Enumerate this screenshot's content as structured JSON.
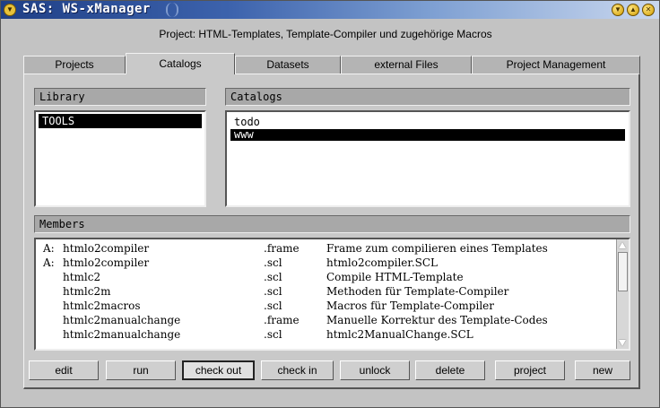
{
  "window": {
    "title": "SAS: WS-xManager"
  },
  "project": {
    "line": "Project: HTML-Templates, Template-Compiler und zugehörige Macros"
  },
  "tabs": [
    {
      "label": "Projects",
      "active": false
    },
    {
      "label": "Catalogs",
      "active": true
    },
    {
      "label": "Datasets",
      "active": false
    },
    {
      "label": "external Files",
      "active": false
    },
    {
      "label": "Project Management",
      "active": false
    }
  ],
  "library": {
    "header": "Library",
    "items": [
      {
        "label": "TOOLS",
        "selected": true
      }
    ]
  },
  "catalogs": {
    "header": "Catalogs",
    "items": [
      {
        "label": "todo",
        "selected": false
      },
      {
        "label": "www",
        "selected": true
      }
    ]
  },
  "members": {
    "header": "Members",
    "rows": [
      {
        "flag": "A:",
        "name": "htmlo2compiler",
        "ext": ".frame",
        "desc": "Frame zum compilieren eines Templates"
      },
      {
        "flag": "A:",
        "name": "htmlo2compiler",
        "ext": ".scl",
        "desc": "htmlo2compiler.SCL"
      },
      {
        "flag": "",
        "name": "htmlc2",
        "ext": ".scl",
        "desc": "Compile HTML-Template"
      },
      {
        "flag": "",
        "name": "htmlc2m",
        "ext": ".scl",
        "desc": "Methoden für Template-Compiler"
      },
      {
        "flag": "",
        "name": "htmlc2macros",
        "ext": ".scl",
        "desc": "Macros für Template-Compiler"
      },
      {
        "flag": "",
        "name": "htmlc2manualchange",
        "ext": ".frame",
        "desc": "Manuelle Korrektur des Template-Codes"
      },
      {
        "flag": "",
        "name": "htmlc2manualchange",
        "ext": ".scl",
        "desc": "htmlc2ManualChange.SCL"
      }
    ]
  },
  "buttons": {
    "edit": "edit",
    "run": "run",
    "check_out": "check out",
    "check_in": "check in",
    "unlock": "unlock",
    "delete": "delete",
    "project": "project",
    "new": "new"
  },
  "icons": {
    "window_menu": "window-menu-icon",
    "minimize": "minimize-icon",
    "maximize": "maximize-icon",
    "close": "close-icon",
    "scroll_up": "scroll-up-icon",
    "scroll_down": "scroll-down-icon"
  },
  "colors": {
    "titlebar_start": "#1f3f86",
    "titlebar_end": "#c9d7ee",
    "selection": "#000000",
    "window_bg": "#c3c3c3"
  }
}
